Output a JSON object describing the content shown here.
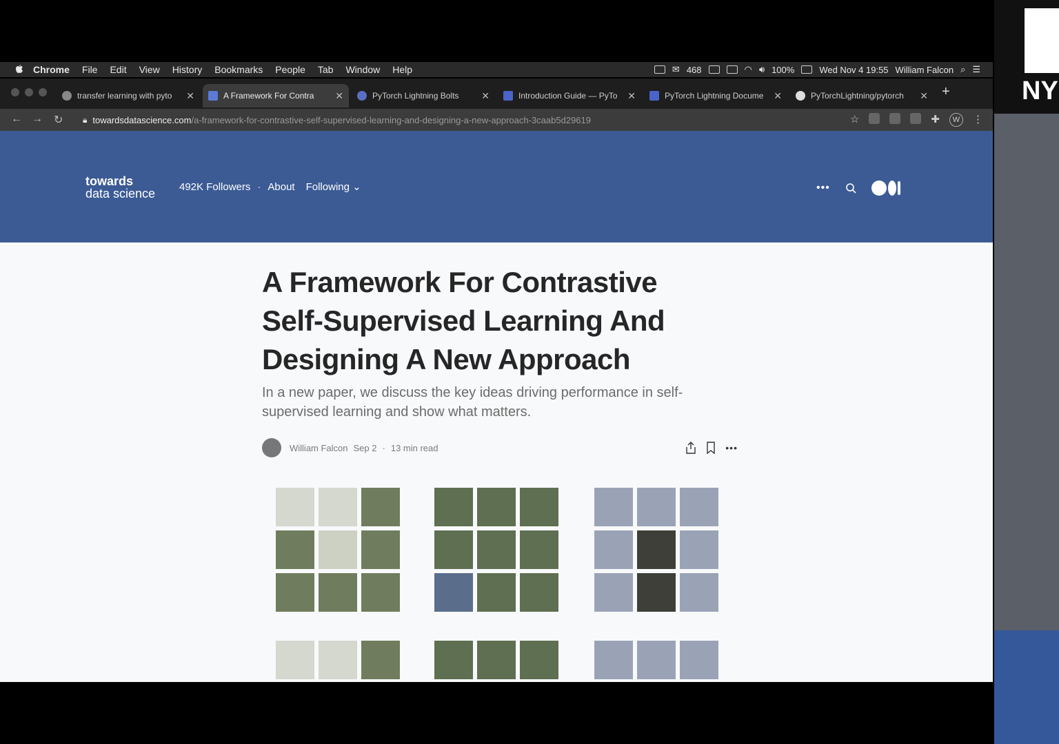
{
  "menubar": {
    "app": "Chrome",
    "items": [
      "File",
      "Edit",
      "View",
      "History",
      "Bookmarks",
      "People",
      "Tab",
      "Window",
      "Help"
    ],
    "status": {
      "mail_count": "468",
      "battery": "100%",
      "datetime": "Wed Nov 4  19:55",
      "user": "William Falcon"
    }
  },
  "tabs": [
    {
      "title": "transfer learning with pyto",
      "active": false
    },
    {
      "title": "A Framework For Contra",
      "active": true
    },
    {
      "title": "PyTorch Lightning Bolts",
      "active": false
    },
    {
      "title": "Introduction Guide — PyTo",
      "active": false
    },
    {
      "title": "PyTorch Lightning Docume",
      "active": false
    },
    {
      "title": "PyTorchLightning/pytorch",
      "active": false
    }
  ],
  "address": {
    "domain": "towardsdatascience.com",
    "path": "/a-framework-for-contrastive-self-supervised-learning-and-designing-a-new-approach-3caab5d29619",
    "profile_initial": "W"
  },
  "publication": {
    "name_top": "towards",
    "name_bottom": "data science",
    "followers": "492K Followers",
    "about": "About",
    "following": "Following"
  },
  "article": {
    "title": "A Framework For Contrastive Self-Supervised Learning And Designing A New Approach",
    "subtitle": "In a new paper, we discuss the key ideas driving performance in self-supervised learning and show what matters.",
    "author": "William Falcon",
    "date": "Sep 2",
    "read_time": "13 min read"
  },
  "side": {
    "logo_text": "NY"
  },
  "colors": {
    "header": "#3c5b95",
    "page": "#f8f9fb",
    "tabbar": "#1e1e1e"
  }
}
